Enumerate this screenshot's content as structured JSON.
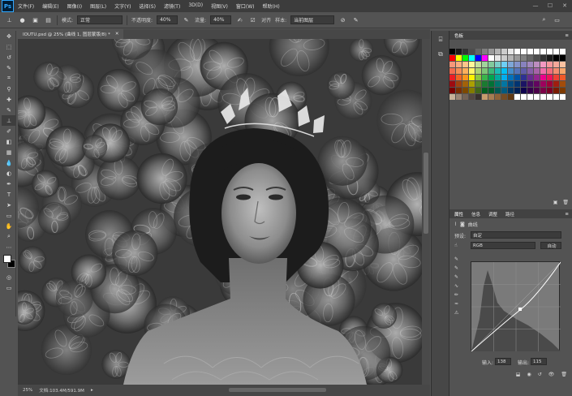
{
  "app": {
    "logo": "Ps"
  },
  "menu": [
    "文件(F)",
    "编辑(E)",
    "图像(I)",
    "图层(L)",
    "文字(Y)",
    "选择(S)",
    "滤镜(T)",
    "3D(D)",
    "视图(V)",
    "窗口(W)",
    "帮助(H)"
  ],
  "options": {
    "mode_label": "模式:",
    "mode_value": "正常",
    "opacity_label": "不透明度:",
    "opacity_value": "40%",
    "flow_label": "流量:",
    "flow_value": "40%",
    "align_label": "对齐",
    "sample_label": "样本:",
    "sample_value": "当前图层"
  },
  "document": {
    "tab_title": "IOUTU.psd @ 25% (曲线 1, 图层蒙版/8) *",
    "zoom": "25%",
    "doc_size": "文档:103.4M/591.9M"
  },
  "swatches": {
    "header": "色板",
    "row1": [
      "#000000",
      "#1a1a1a",
      "#333333",
      "#4d4d4d",
      "#666666",
      "#808080",
      "#999999",
      "#b3b3b3",
      "#cccccc",
      "#e6e6e6",
      "#ffffff",
      "#ffffff",
      "#ffffff",
      "#ffffff",
      "#ffffff",
      "#ffffff",
      "#ffffff",
      "#ffffff"
    ],
    "row2": [
      "#ff0000",
      "#ffff00",
      "#00ff00",
      "#00ffff",
      "#0000ff",
      "#ff00ff",
      "#ffffff",
      "#e6e6e6",
      "#cccccc",
      "#b3b3b3",
      "#999999",
      "#808080",
      "#666666",
      "#4d4d4d",
      "#333333",
      "#1a1a1a",
      "#000000",
      "#000000"
    ],
    "rows_palette": [
      [
        "#f7977a",
        "#f9ad81",
        "#fdc68a",
        "#fff79a",
        "#c4df9b",
        "#a2d39c",
        "#82ca9d",
        "#7bcdc8",
        "#6ecff6",
        "#7ea7d8",
        "#8493ca",
        "#8882be",
        "#a187be",
        "#bc8dbf",
        "#f49ac2",
        "#f6989d",
        "#f5a89a",
        "#fbc3a1"
      ],
      [
        "#f26c4f",
        "#f68e55",
        "#fbaf5c",
        "#fff467",
        "#acd372",
        "#7cc576",
        "#3bb878",
        "#1abbb4",
        "#00bff3",
        "#438cca",
        "#5574b9",
        "#605ca8",
        "#855fa8",
        "#a763a8",
        "#f06eaa",
        "#f26d7d",
        "#f48c70",
        "#f9a66b"
      ],
      [
        "#ed1c24",
        "#f26522",
        "#f7941d",
        "#fff200",
        "#8dc63f",
        "#39b54a",
        "#00a651",
        "#00a99d",
        "#00aeef",
        "#0072bc",
        "#0054a6",
        "#2e3192",
        "#662d91",
        "#92278f",
        "#ec008c",
        "#ed145b",
        "#ee4035",
        "#f15a29"
      ],
      [
        "#9e0b0f",
        "#a0410d",
        "#a36209",
        "#aba000",
        "#598527",
        "#1a7b30",
        "#007236",
        "#00746b",
        "#0076a3",
        "#004b80",
        "#003471",
        "#1b1464",
        "#440e62",
        "#630460",
        "#9e005d",
        "#9e0039",
        "#a11d0f",
        "#a34c0a"
      ],
      [
        "#790000",
        "#7b2e00",
        "#7d4900",
        "#827b00",
        "#406618",
        "#005e20",
        "#005826",
        "#005952",
        "#005b7f",
        "#003663",
        "#002157",
        "#0d004c",
        "#32004b",
        "#4b0049",
        "#7b0046",
        "#7a0026",
        "#7a1a00",
        "#7c3a00"
      ],
      [
        "#c7b299",
        "#998675",
        "#736357",
        "#534741",
        "#37302d",
        "#c69c6d",
        "#a67c52",
        "#8c6239",
        "#754c24",
        "#603913",
        "#ffffff",
        "#ffffff",
        "#ffffff",
        "#ffffff",
        "#ffffff",
        "#ffffff",
        "#ffffff",
        "#ffffff"
      ]
    ]
  },
  "properties": {
    "tabs": [
      "属性",
      "信息",
      "调整",
      "路径"
    ],
    "title": "曲线",
    "preset_label": "预设:",
    "preset_value": "自定",
    "channel_value": "RGB",
    "auto_button": "自动",
    "input_label": "输入:",
    "input_value": "138",
    "output_label": "输出:",
    "output_value": "115"
  }
}
